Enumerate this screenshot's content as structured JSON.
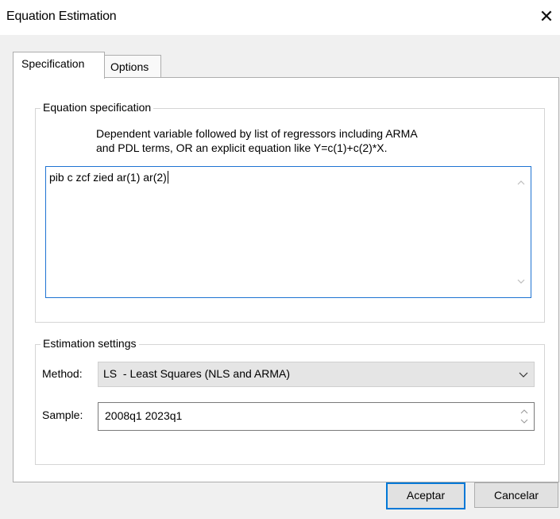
{
  "window": {
    "title": "Equation Estimation",
    "close_glyph": "✕"
  },
  "tabs": [
    {
      "label": "Specification",
      "active": true
    },
    {
      "label": "Options",
      "active": false
    }
  ],
  "equation_specification": {
    "legend": "Equation specification",
    "description_line1": "Dependent variable followed by list of regressors including ARMA",
    "description_line2": "and PDL terms, OR an explicit equation like Y=c(1)+c(2)*X.",
    "value": "pib c zcf zied ar(1) ar(2)"
  },
  "estimation_settings": {
    "legend": "Estimation settings",
    "method_label": "Method:",
    "method_value": "LS  - Least Squares (NLS and ARMA)",
    "sample_label": "Sample:",
    "sample_value": "2008q1 2023q1"
  },
  "buttons": {
    "ok": "Aceptar",
    "cancel": "Cancelar"
  },
  "colors": {
    "focus_border": "#1e73d2",
    "default_button_border": "#0078d7",
    "dialog_bg": "#f0f0f0"
  },
  "icons": [
    "close-icon",
    "scroll-up-icon",
    "scroll-down-icon",
    "chevron-down-icon",
    "spin-up-icon",
    "spin-down-icon"
  ]
}
